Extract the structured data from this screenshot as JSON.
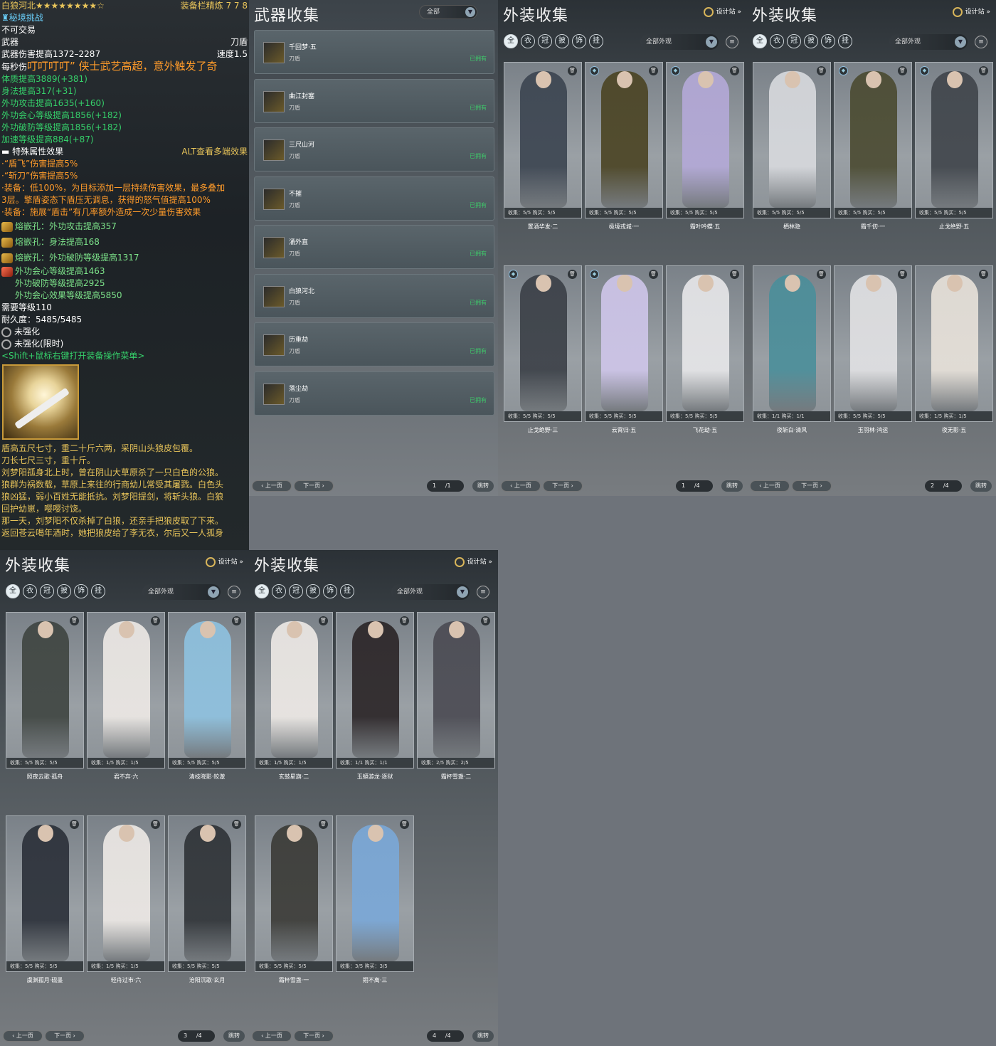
{
  "tooltip": {
    "item_name": "白狼河北",
    "stars": "★★★★★★★★☆",
    "refine_label": "装备栏精炼",
    "refine_value": "7 7 8",
    "challenge": "秘境挑战",
    "untradable": "不可交易",
    "slot": "武器",
    "weapon_type": "刀盾",
    "damage": "武器伤害提高1372–2287",
    "speed": "速度1.5",
    "dps_prefix": "每秒伤",
    "broadcast": "叮叮叮叮” 侠士武艺高超，意外触发了奇",
    "stats": [
      {
        "text": "体质提高3889",
        "bonus": "(+381)"
      },
      {
        "text": "身法提高317",
        "bonus": "(+31)"
      },
      {
        "text": "外功攻击提高1635",
        "bonus": "(+160)"
      },
      {
        "text": "外功会心等级提高1856",
        "bonus": "(+182)"
      },
      {
        "text": "外功破防等级提高1856",
        "bonus": "(+182)"
      },
      {
        "text": "加速等级提高884",
        "bonus": "(+87)"
      }
    ],
    "special_header": "特殊属性效果",
    "alt_hint": "ALT查看多端效果",
    "effects": [
      "·“盾飞”伤害提高5%",
      "·“斩刀”伤害提高5%",
      "·装备：低100%，为目标添加一层持续伤害效果，最多叠加",
      "3层。擎盾姿态下盾压无调息，获得的怒气值提高100%",
      "·装备：施展“盾击”有几率额外造成一次少量伤害效果"
    ],
    "sockets": [
      "熔嵌孔：外功攻击提高357",
      "熔嵌孔：身法提高168",
      "熔嵌孔：外功破防等级提高1317"
    ],
    "big_socket": [
      "外功会心等级提高1463",
      "外功破防等级提高2925",
      "外功会心效果等级提高5850"
    ],
    "require_level": "需要等级110",
    "durability": "耐久度：5485/5485",
    "unstrengthened": "未强化",
    "unstrengthened_limited": "未强化(限时)",
    "shift_hint": "<Shift+鼠标右键打开装备操作菜单>",
    "lore": [
      "盾高五尺七寸，重二十斤六两，采阴山头狼皮包覆。",
      "刀长七尺三寸，重十斤。",
      "刘梦阳孤身北上时，曾在阴山大草原杀了一只白色的公狼。",
      "狼群为祸数载，草原上来往的行商幼儿常受其屠戮。白色头",
      "狼凶猛，弱小百姓无能抵抗。刘梦阳提剑，将斩头狼。白狼",
      "回护幼崽，嘤嘤讨饶。",
      "那一天，刘梦阳不仅杀掉了白狼，还亲手把狼皮取了下来。",
      "返回苍云喝年酒时，她把狼皮给了李无衣，尔后又一人孤身"
    ]
  },
  "weapon_panel": {
    "title": "武器收集",
    "filter": "全部",
    "type_label": "刀盾",
    "owned_label": "已拥有",
    "items": [
      "千回梦·五",
      "曲江封塞",
      "三尺山河",
      "不摧",
      "涌外直",
      "白狼河北",
      "历重劫",
      "落尘劫"
    ],
    "prev": "上一页",
    "next": "下一页",
    "page": "1",
    "total": "/1",
    "jump": "跳转"
  },
  "outfit_common": {
    "title": "外装收集",
    "design": "设计站",
    "filter": "全部外观",
    "prev": "上一页",
    "next": "下一页",
    "jump": "跳转"
  },
  "outfit_pages": [
    {
      "page": "1",
      "total": "/4",
      "cards": [
        {
          "name": "置酒华发·二",
          "collect": "5/5",
          "buy": "5/5",
          "badge": false,
          "color": "#3b4450"
        },
        {
          "name": "极境戎城·一",
          "collect": "5/5",
          "buy": "5/5",
          "badge": true,
          "color": "#4a4322"
        },
        {
          "name": "霜叶吟蝶·五",
          "collect": "5/5",
          "buy": "5/5",
          "badge": true,
          "color": "#b4a9d8"
        },
        {
          "name": "止戈绝野·三",
          "collect": "5/5",
          "buy": "5/5",
          "badge": true,
          "color": "#3a3f46"
        },
        {
          "name": "云霄归·五",
          "collect": "5/5",
          "buy": "5/5",
          "badge": true,
          "color": "#cfc6ea"
        },
        {
          "name": "飞花劫·五",
          "collect": "5/5",
          "buy": "5/5",
          "badge": false,
          "color": "#e8e8ea"
        }
      ]
    },
    {
      "page": "2",
      "total": "/4",
      "cards": [
        {
          "name": "栖林隐",
          "collect": "5/5",
          "buy": "5/5",
          "badge": false,
          "color": "#d8dade"
        },
        {
          "name": "霜千仞·一",
          "collect": "5/5",
          "buy": "5/5",
          "badge": true,
          "color": "#4a4a30"
        },
        {
          "name": "止戈绝野·五",
          "collect": "5/5",
          "buy": "5/5",
          "badge": true,
          "color": "#3f444a"
        },
        {
          "name": "夜斩白·清风",
          "collect": "1/1",
          "buy": "1/1",
          "badge": false,
          "color": "#4a8e9a"
        },
        {
          "name": "玉羽林·鸿运",
          "collect": "5/5",
          "buy": "5/5",
          "badge": false,
          "color": "#e2e2e4"
        },
        {
          "name": "夜无影·五",
          "collect": "1/5",
          "buy": "1/5",
          "badge": false,
          "color": "#e8e2da"
        }
      ]
    },
    {
      "page": "3",
      "total": "/4",
      "cards": [
        {
          "name": "照夜云歌·孤舟",
          "collect": "5/5",
          "buy": "5/5",
          "badge": false,
          "color": "#3e4440"
        },
        {
          "name": "君不弃·六",
          "collect": "1/5",
          "buy": "1/5",
          "badge": false,
          "color": "#eeeae6"
        },
        {
          "name": "清枝晓影·皎澈",
          "collect": "5/5",
          "buy": "5/5",
          "badge": false,
          "color": "#8ec2e0"
        },
        {
          "name": "虞渊孤月·砚墨",
          "collect": "5/5",
          "buy": "5/5",
          "badge": false,
          "color": "#2a2f38"
        },
        {
          "name": "轻舟过市·六",
          "collect": "1/5",
          "buy": "1/5",
          "badge": false,
          "color": "#eeeae6"
        },
        {
          "name": "沧阳沉歌·玄月",
          "collect": "5/5",
          "buy": "5/5",
          "badge": false,
          "color": "#2e3236"
        }
      ]
    },
    {
      "page": "4",
      "total": "/4",
      "cards": [
        {
          "name": "玄鼓星旗·二",
          "collect": "1/5",
          "buy": "1/5",
          "badge": false,
          "color": "#eeeae6"
        },
        {
          "name": "玉蟒游龙·逐狱",
          "collect": "1/1",
          "buy": "1/1",
          "badge": false,
          "color": "#2a2426"
        },
        {
          "name": "霜杯雪盏·二",
          "collect": "2/5",
          "buy": "2/5",
          "badge": false,
          "color": "#4a4a52"
        },
        {
          "name": "霜杯雪盏·一",
          "collect": "5/5",
          "buy": "5/5",
          "badge": false,
          "color": "#3a3a36"
        },
        {
          "name": "期不离·三",
          "collect": "3/5",
          "buy": "3/5",
          "badge": false,
          "color": "#7aa8d8"
        }
      ]
    }
  ],
  "labels": {
    "collect": "收集：",
    "buy": "购买："
  }
}
